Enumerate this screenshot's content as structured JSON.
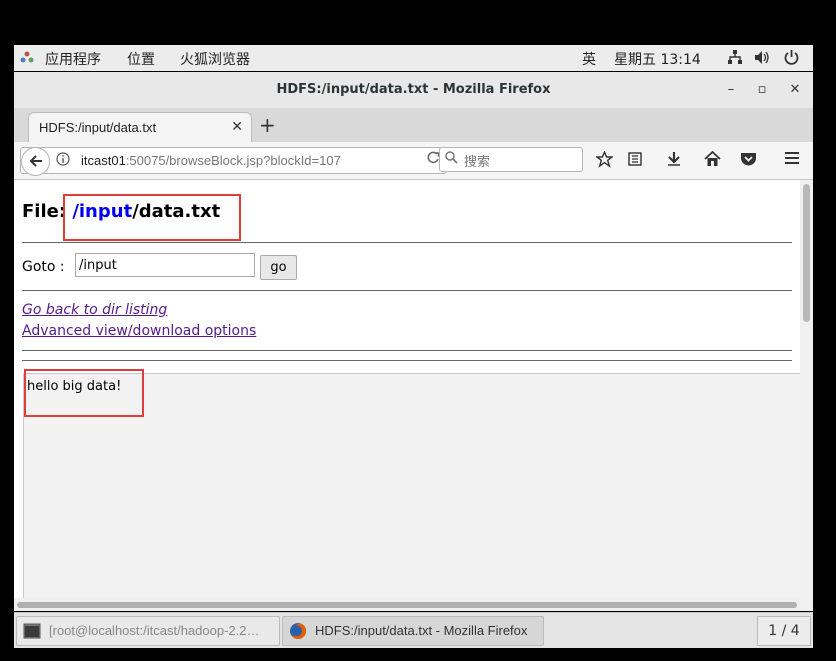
{
  "topbar": {
    "apps": "应用程序",
    "places": "位置",
    "firefox": "火狐浏览器",
    "ime": "英",
    "clock": "星期五 13:14"
  },
  "window": {
    "title": "HDFS:/input/data.txt - Mozilla Firefox",
    "minimize": "–",
    "maximize": "▫",
    "close": "✕"
  },
  "tab": {
    "label": "HDFS:/input/data.txt",
    "close": "✕",
    "new": "+"
  },
  "nav": {
    "url_host": "itcast01",
    "url_rest": ":50075/browseBlock.jsp?blockId=107",
    "search_placeholder": "搜索"
  },
  "page": {
    "file_label": "File: ",
    "file_link": "/input",
    "file_rest": "/data.txt",
    "goto_label": "Goto :",
    "goto_value": "/input",
    "go_button": "go",
    "back_link": "Go back to dir listing",
    "advanced_link": "Advanced view/download options",
    "file_content": "hello big data!"
  },
  "taskbar": {
    "terminal": "[root@localhost:/itcast/hadoop-2.2…",
    "firefox": "HDFS:/input/data.txt - Mozilla Firefox",
    "pager": "1 / 4"
  },
  "colors": {
    "highlight": "#e03c3c",
    "link": "#0000ee",
    "visited": "#551a8b"
  }
}
